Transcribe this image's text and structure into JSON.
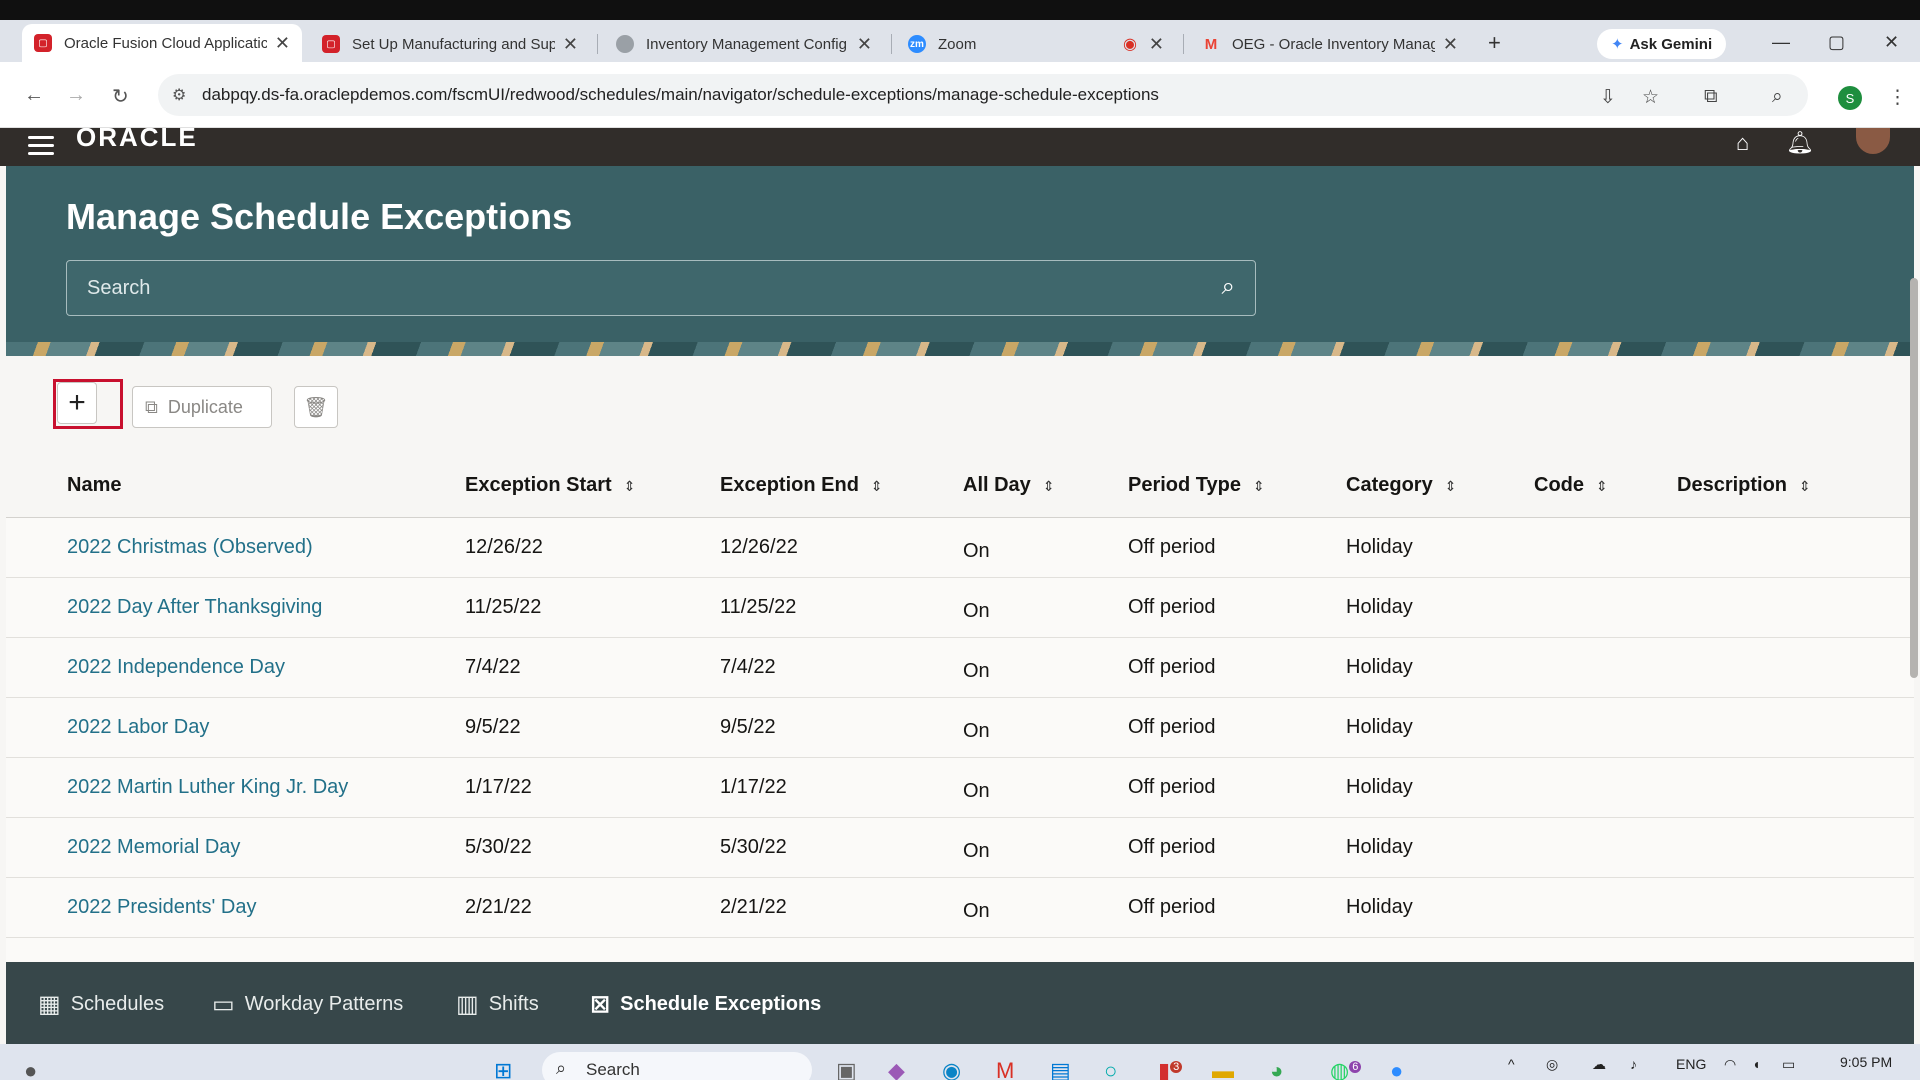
{
  "browser": {
    "tabs": [
      {
        "title": "Oracle Fusion Cloud Applicatic",
        "active": true,
        "favicon_color": "#d3222a"
      },
      {
        "title": "Set Up Manufacturing and Sup",
        "active": false,
        "favicon_color": "#d3222a"
      },
      {
        "title": "Inventory Management Config",
        "active": false,
        "favicon_color": "#9aa0a6"
      },
      {
        "title": "Zoom",
        "active": false,
        "favicon_color": "#2d8cff",
        "favicon_text": "zm"
      },
      {
        "title": "OEG - Oracle Inventory Manag",
        "active": false,
        "favicon_color": "#ea4335",
        "favicon_text": "M"
      }
    ],
    "gemini_label": "Ask Gemini",
    "url": "dabpqy.ds-fa.oraclepdemos.com/fscmUI/redwood/schedules/main/navigator/schedule-exceptions/manage-schedule-exceptions",
    "profile_initial": "S"
  },
  "app": {
    "logo": "ORACLE",
    "page_title": "Manage Schedule Exceptions",
    "search_placeholder": "Search",
    "toolbar": {
      "add_label": "+",
      "duplicate_label": "Duplicate"
    },
    "table": {
      "columns": [
        "Name",
        "Exception Start",
        "Exception End",
        "All Day",
        "Period Type",
        "Category",
        "Code",
        "Description"
      ],
      "rows": [
        {
          "name": "2022 Christmas (Observed)",
          "start": "12/26/22",
          "end": "12/26/22",
          "all_day": "On",
          "period_type": "Off period",
          "category": "Holiday",
          "code": "",
          "description": ""
        },
        {
          "name": "2022 Day After Thanksgiving",
          "start": "11/25/22",
          "end": "11/25/22",
          "all_day": "On",
          "period_type": "Off period",
          "category": "Holiday",
          "code": "",
          "description": ""
        },
        {
          "name": "2022 Independence Day",
          "start": "7/4/22",
          "end": "7/4/22",
          "all_day": "On",
          "period_type": "Off period",
          "category": "Holiday",
          "code": "",
          "description": ""
        },
        {
          "name": "2022 Labor Day",
          "start": "9/5/22",
          "end": "9/5/22",
          "all_day": "On",
          "period_type": "Off period",
          "category": "Holiday",
          "code": "",
          "description": ""
        },
        {
          "name": "2022 Martin Luther King Jr. Day",
          "start": "1/17/22",
          "end": "1/17/22",
          "all_day": "On",
          "period_type": "Off period",
          "category": "Holiday",
          "code": "",
          "description": ""
        },
        {
          "name": "2022 Memorial Day",
          "start": "5/30/22",
          "end": "5/30/22",
          "all_day": "On",
          "period_type": "Off period",
          "category": "Holiday",
          "code": "",
          "description": ""
        },
        {
          "name": "2022 Presidents' Day",
          "start": "2/21/22",
          "end": "2/21/22",
          "all_day": "On",
          "period_type": "Off period",
          "category": "Holiday",
          "code": "",
          "description": ""
        }
      ]
    },
    "bottom_nav": [
      {
        "label": "Schedules",
        "icon": "calendar-grid-icon",
        "active": false
      },
      {
        "label": "Workday Patterns",
        "icon": "pattern-icon",
        "active": false
      },
      {
        "label": "Shifts",
        "icon": "shifts-icon",
        "active": false
      },
      {
        "label": "Schedule Exceptions",
        "icon": "calendar-x-icon",
        "active": true
      }
    ]
  },
  "taskbar": {
    "search_label": "Search",
    "lang": "ENG",
    "time": "9:05 PM",
    "badges": {
      "mail": "3",
      "whatsapp": "6"
    }
  },
  "colors": {
    "hero_bg": "#3a6166",
    "link": "#227089",
    "highlight": "#c8102e",
    "bottom_nav_bg": "#37474a"
  }
}
